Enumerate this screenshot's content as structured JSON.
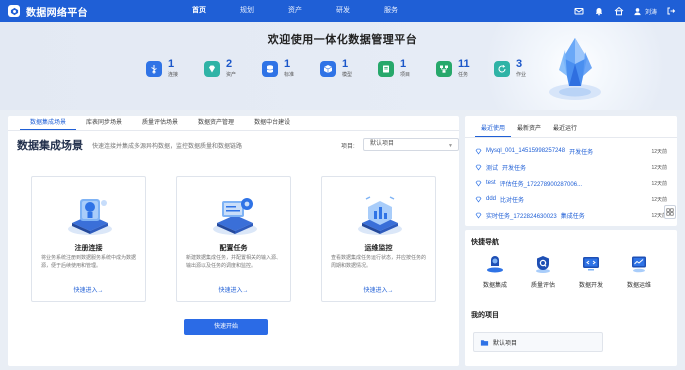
{
  "brand": {
    "title": "数据网络平台"
  },
  "nav": [
    {
      "label": "首页",
      "active": true
    },
    {
      "label": "规划",
      "active": false
    },
    {
      "label": "资产",
      "active": false
    },
    {
      "label": "研发",
      "active": false
    },
    {
      "label": "服务",
      "active": false
    }
  ],
  "user": {
    "name": "刘涛"
  },
  "hero": {
    "title": "欢迎使用一体化数据管理平台",
    "stats": [
      {
        "num": "1",
        "label": "连接",
        "icon": "usb-icon",
        "color": "#2f73e6"
      },
      {
        "num": "2",
        "label": "资产",
        "icon": "diamond-icon",
        "color": "#2fb3a6"
      },
      {
        "num": "1",
        "label": "标准",
        "icon": "database-icon",
        "color": "#2f73e6"
      },
      {
        "num": "1",
        "label": "模型",
        "icon": "cube-icon",
        "color": "#2f73e6"
      },
      {
        "num": "1",
        "label": "项目",
        "icon": "book-icon",
        "color": "#27a86b"
      },
      {
        "num": "11",
        "label": "任务",
        "icon": "flow-icon",
        "color": "#27a86b"
      },
      {
        "num": "3",
        "label": "作业",
        "icon": "cycle-icon",
        "color": "#2fb3a6"
      }
    ]
  },
  "tabs": [
    {
      "label": "数据集成场景",
      "active": true
    },
    {
      "label": "库表同步场景",
      "active": false
    },
    {
      "label": "质量评估场景",
      "active": false
    },
    {
      "label": "数据资产管理",
      "active": false
    },
    {
      "label": "数据中台建设",
      "active": false
    }
  ],
  "scene": {
    "title": "数据集成场景",
    "desc": "快速连接并集成多源异构数据，监控数据质量和数据链路",
    "project_label": "项目:",
    "project_value": "默认项目"
  },
  "cards": [
    {
      "title": "注册连接",
      "desc": "将业务系统注册到数据服务系统中成为数据源，便于后续使用和管理。",
      "link": "快速进入→"
    },
    {
      "title": "配置任务",
      "desc": "新建数据集成任务，并配置相关的输入源、输出源以及任务的调度和监控。",
      "link": "快速进入→"
    },
    {
      "title": "运维监控",
      "desc": "查看数据集成任务运行状态，并应按任务的周期和数据情况。",
      "link": "快速进入→"
    }
  ],
  "start_button": "快速开始",
  "right_tabs": [
    {
      "label": "最近使用",
      "active": true
    },
    {
      "label": "最新资产",
      "active": false
    },
    {
      "label": "最近运行",
      "active": false
    }
  ],
  "recent": [
    {
      "name": "Mysql_001_14515998257248",
      "type": "开发任务",
      "time": "12天前"
    },
    {
      "name": "测试",
      "type": "开发任务",
      "time": "12天前"
    },
    {
      "name": "test",
      "type": "评估任务_172278900287006...",
      "time": "12天前"
    },
    {
      "name": "ddd",
      "type": "比对任务",
      "time": "12天前"
    },
    {
      "name": "实时任务_1722824630023",
      "type": "集成任务",
      "time": "12天前"
    }
  ],
  "quick_nav": {
    "title": "快捷导航",
    "items": [
      {
        "label": "数据集成",
        "icon": "integration-icon"
      },
      {
        "label": "质量评估",
        "icon": "quality-shield-icon"
      },
      {
        "label": "数据开发",
        "icon": "code-monitor-icon"
      },
      {
        "label": "数据运维",
        "icon": "ops-monitor-icon"
      }
    ]
  },
  "my_projects": {
    "title": "我的项目",
    "items": [
      {
        "label": "默认项目"
      }
    ]
  },
  "colors": {
    "primary": "#1f5fd6",
    "page_bg": "#e9eef5"
  }
}
